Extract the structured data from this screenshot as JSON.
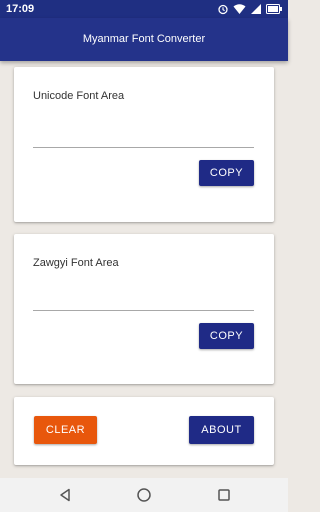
{
  "status_bar": {
    "time": "17:09",
    "icons": [
      "alarm-icon",
      "wifi-icon",
      "signal-icon",
      "battery-icon"
    ]
  },
  "app_bar": {
    "title": "Myanmar Font Converter"
  },
  "unicode_card": {
    "label": "Unicode Font Area",
    "value": "",
    "copy_label": "COPY"
  },
  "zawgyi_card": {
    "label": "Zawgyi Font Area",
    "value": "",
    "copy_label": "COPY"
  },
  "actions": {
    "clear_label": "CLEAR",
    "about_label": "ABOUT"
  },
  "nav": {
    "icons": [
      "back-icon",
      "home-icon",
      "recent-apps-icon"
    ]
  },
  "colors": {
    "primary": "#24338a",
    "status_bar": "#1f2f82",
    "button_primary": "#1f2a86",
    "button_accent": "#e8570c",
    "background": "#ede9e4"
  }
}
